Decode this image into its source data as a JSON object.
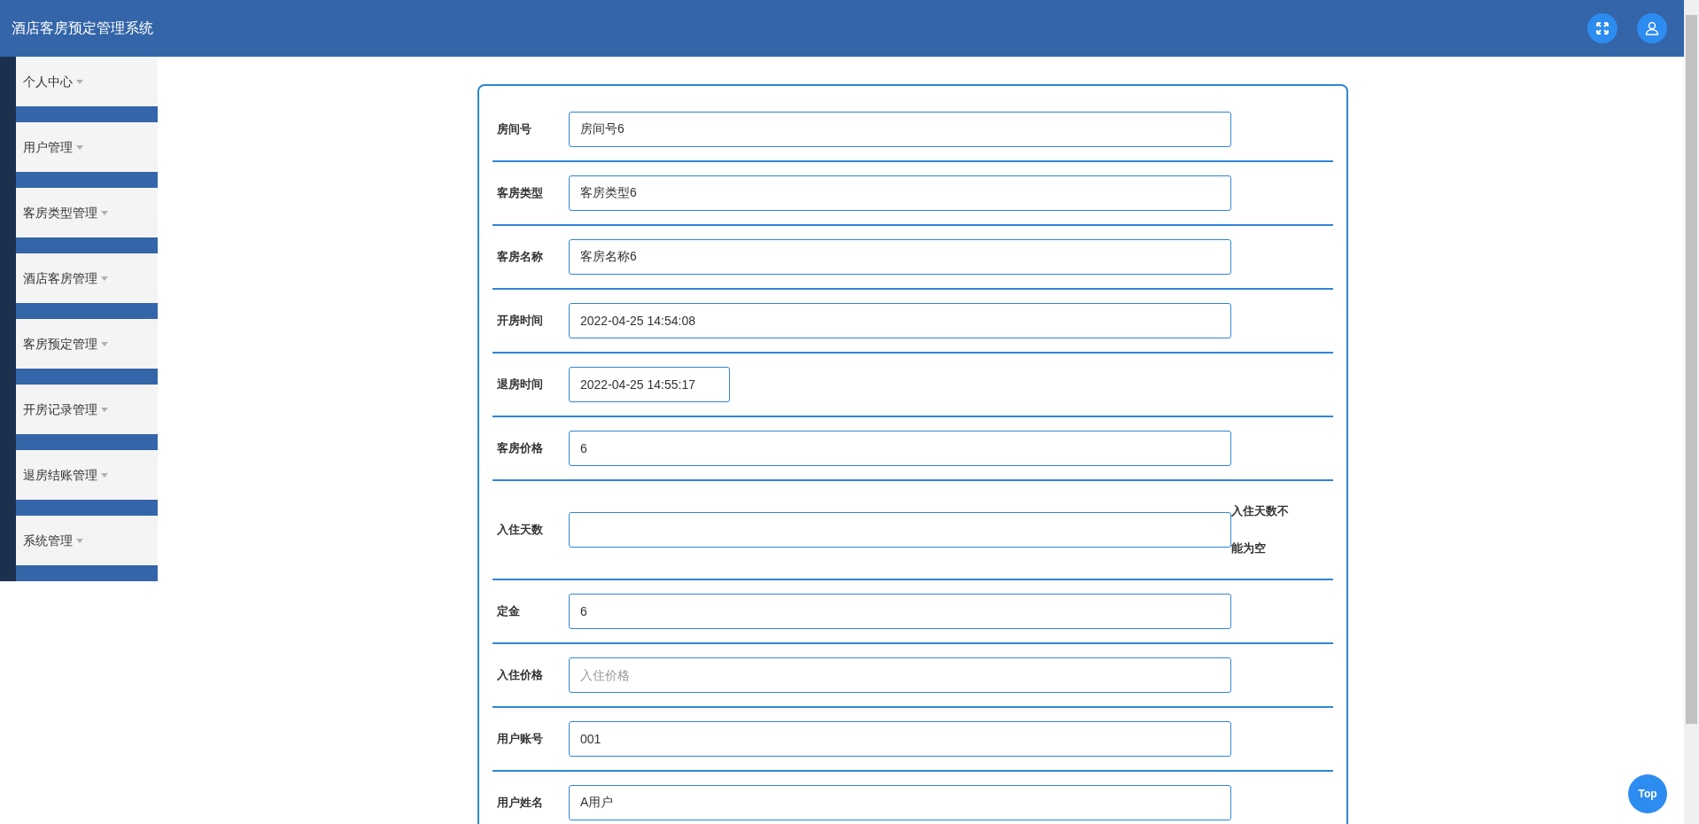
{
  "header": {
    "title": "酒店客房预定管理系统"
  },
  "sidebar": {
    "items": [
      {
        "label": "个人中心",
        "expanded": false
      },
      {
        "label": "用户管理",
        "expanded": false
      },
      {
        "label": "客房类型管理",
        "expanded": false
      },
      {
        "label": "酒店客房管理",
        "expanded": false
      },
      {
        "label": "客房预定管理",
        "expanded": false
      },
      {
        "label": "开房记录管理",
        "expanded": false
      },
      {
        "label": "退房结账管理",
        "expanded": false
      },
      {
        "label": "系统管理",
        "expanded": false
      }
    ]
  },
  "form": {
    "fields": [
      {
        "label": "房间号",
        "kind": "wide",
        "value": "房间号6"
      },
      {
        "label": "客房类型",
        "kind": "wide",
        "value": "客房类型6"
      },
      {
        "label": "客房名称",
        "kind": "wide",
        "value": "客房名称6"
      },
      {
        "label": "开房时间",
        "kind": "wide",
        "value": "2022-04-25 14:54:08"
      },
      {
        "label": "退房时间",
        "kind": "narrow",
        "value": "2022-04-25 14:55:17"
      },
      {
        "label": "客房价格",
        "kind": "wide",
        "value": "6"
      },
      {
        "label": "入住天数",
        "kind": "wide",
        "error": "入住天数不能为空"
      },
      {
        "label": "定金",
        "kind": "wide",
        "value": "6"
      },
      {
        "label": "入住价格",
        "kind": "wide",
        "placeholder": "入住价格"
      },
      {
        "label": "用户账号",
        "kind": "wide",
        "value": "001"
      },
      {
        "label": "用户姓名",
        "kind": "wide",
        "value": "A用户"
      }
    ]
  },
  "top_button": {
    "label": "Top"
  }
}
